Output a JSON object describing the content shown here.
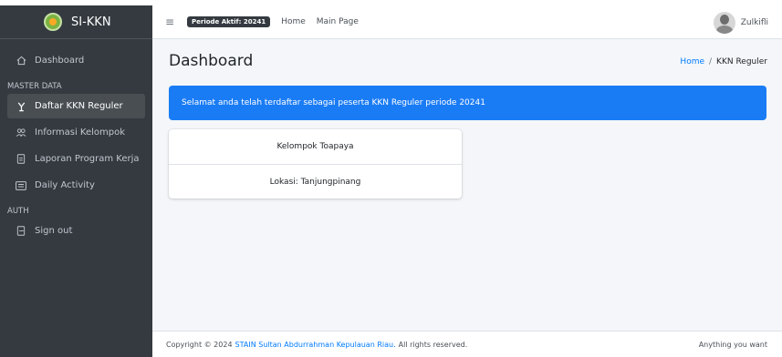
{
  "sidebar": {
    "brand": "SI-KKN",
    "items": [
      {
        "label": "Dashboard",
        "icon": "home-icon"
      },
      {
        "header": "MASTER DATA"
      },
      {
        "label": "Daftar KKN Reguler",
        "icon": "user-icon",
        "active": true
      },
      {
        "label": "Informasi Kelompok",
        "icon": "users-icon"
      },
      {
        "label": "Laporan Program Kerja",
        "icon": "file-icon"
      },
      {
        "label": "Daily Activity",
        "icon": "list-icon"
      },
      {
        "header": "AUTH"
      },
      {
        "label": "Sign out",
        "icon": "signout-icon"
      }
    ]
  },
  "navbar": {
    "periode_badge": "Periode Aktif: 20241",
    "links": [
      "Home",
      "Main Page"
    ],
    "user_name": "Zulkifli"
  },
  "content": {
    "title": "Dashboard",
    "breadcrumb": {
      "home": "Home",
      "separator": "/",
      "current": "KKN Reguler"
    },
    "alert": "Selamat anda telah terdaftar sebagai peserta KKN Reguler periode 20241",
    "card": {
      "group": "Kelompok Toapaya",
      "location": "Lokasi: Tanjungpinang"
    }
  },
  "footer": {
    "copyright_prefix": "Copyright © 2024",
    "institution": "STAIN Sultan Abdurrahman Kepulauan Riau.",
    "rights": "All rights reserved.",
    "right_text": "Anything you want"
  },
  "colors": {
    "sidebar_bg": "#343a40",
    "alert_bg": "#1a7cf5",
    "link": "#007bff",
    "content_bg": "#f4f6f9"
  }
}
